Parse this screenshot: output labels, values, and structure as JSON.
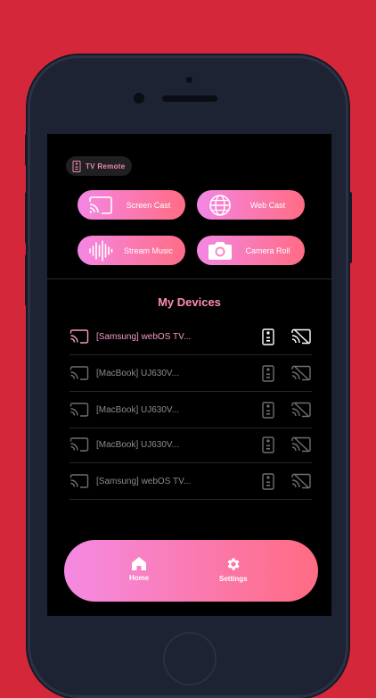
{
  "app": {
    "badge_label": "TV Remote"
  },
  "actions": [
    {
      "label": "Screen Cast",
      "icon": "cast-icon"
    },
    {
      "label": "Web Cast",
      "icon": "globe-icon"
    },
    {
      "label": "Stream Music",
      "icon": "sound-wave-icon"
    },
    {
      "label": "Camera Roll",
      "icon": "camera-icon"
    }
  ],
  "devices_title": "My Devices",
  "devices": [
    {
      "name": "[Samsung] webOS TV...",
      "active": true
    },
    {
      "name": "[MacBook] UJ630V...",
      "active": false
    },
    {
      "name": "[MacBook] UJ630V...",
      "active": false
    },
    {
      "name": "[MacBook] UJ630V...",
      "active": false
    },
    {
      "name": "[Samsung] webOS TV...",
      "active": false
    }
  ],
  "tabbar": {
    "home_label": "Home",
    "settings_label": "Settings"
  },
  "colors": {
    "background": "#d4283a",
    "accent_start": "#f487e4",
    "accent_end": "#ff6c84",
    "title": "#ff8ab8"
  }
}
